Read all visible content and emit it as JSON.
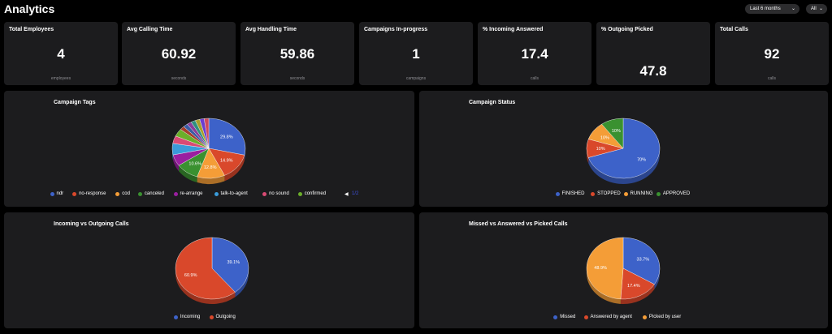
{
  "header": {
    "title": "Analytics",
    "range_select": "Last 6 months",
    "filter_select": "All"
  },
  "kpis": [
    {
      "title": "Total Employees",
      "value": "4",
      "unit": "employees"
    },
    {
      "title": "Avg Calling Time",
      "value": "60.92",
      "unit": "seconds"
    },
    {
      "title": "Avg Handling Time",
      "value": "59.86",
      "unit": "seconds"
    },
    {
      "title": "Campaigns In-progress",
      "value": "1",
      "unit": "campaigns"
    },
    {
      "title": "% Incoming Answered",
      "value": "17.4",
      "unit": "calls"
    },
    {
      "title": "% Outgoing Picked",
      "value": "47.8",
      "unit": ""
    },
    {
      "title": "Total Calls",
      "value": "92",
      "unit": "calls"
    }
  ],
  "chart_data": [
    {
      "type": "pie",
      "title": "Campaign Tags",
      "labels": [
        "ndr",
        "no-response",
        "cod",
        "canceled",
        "re-arrange",
        "talk-to-agent",
        "no sound",
        "confirmed",
        "",
        "",
        "",
        "",
        "",
        "",
        ""
      ],
      "values": [
        29.8,
        14.9,
        12.8,
        10.6,
        6.4,
        6.4,
        4.3,
        4.3,
        2.1,
        2.1,
        2.1,
        2.1,
        2.1,
        2.1,
        2.1
      ],
      "slice_labels": [
        "29.8%",
        "14.9%",
        "12.8%",
        "10.6%"
      ],
      "colors": [
        "#3d62c9",
        "#d9482b",
        "#f49d37",
        "#3a9130",
        "#9a1fa0",
        "#3a9bd9",
        "#d94a74",
        "#6bae2a",
        "#a53e2c",
        "#3a5ca5",
        "#8a3d9a",
        "#2f8f80",
        "#a89f2a",
        "#6a3ed1",
        "#cf4a5c"
      ],
      "legend_pager": "1/2"
    },
    {
      "type": "pie",
      "title": "Campaign Status",
      "labels": [
        "FINISHED",
        "STOPPED",
        "RUNNING",
        "APPROVED"
      ],
      "values": [
        70,
        10,
        10,
        10
      ],
      "slice_labels": [
        "70%",
        "10%",
        "10%",
        "10%"
      ],
      "colors": [
        "#3d62c9",
        "#d9482b",
        "#f49d37",
        "#3a9130"
      ]
    },
    {
      "type": "pie",
      "title": "Incoming vs Outgoing Calls",
      "labels": [
        "Incoming",
        "Outgoing"
      ],
      "values": [
        39.1,
        60.9
      ],
      "slice_labels": [
        "39.1%",
        "60.9%"
      ],
      "colors": [
        "#3d62c9",
        "#d9482b"
      ]
    },
    {
      "type": "pie",
      "title": "Missed vs Answered vs Picked Calls",
      "labels": [
        "Missed",
        "Answered by agent",
        "Picked by user"
      ],
      "values": [
        33.7,
        17.4,
        48.9
      ],
      "slice_labels": [
        "33.7%",
        "17.4%",
        "48.9%"
      ],
      "colors": [
        "#3d62c9",
        "#d9482b",
        "#f49d37"
      ]
    }
  ]
}
